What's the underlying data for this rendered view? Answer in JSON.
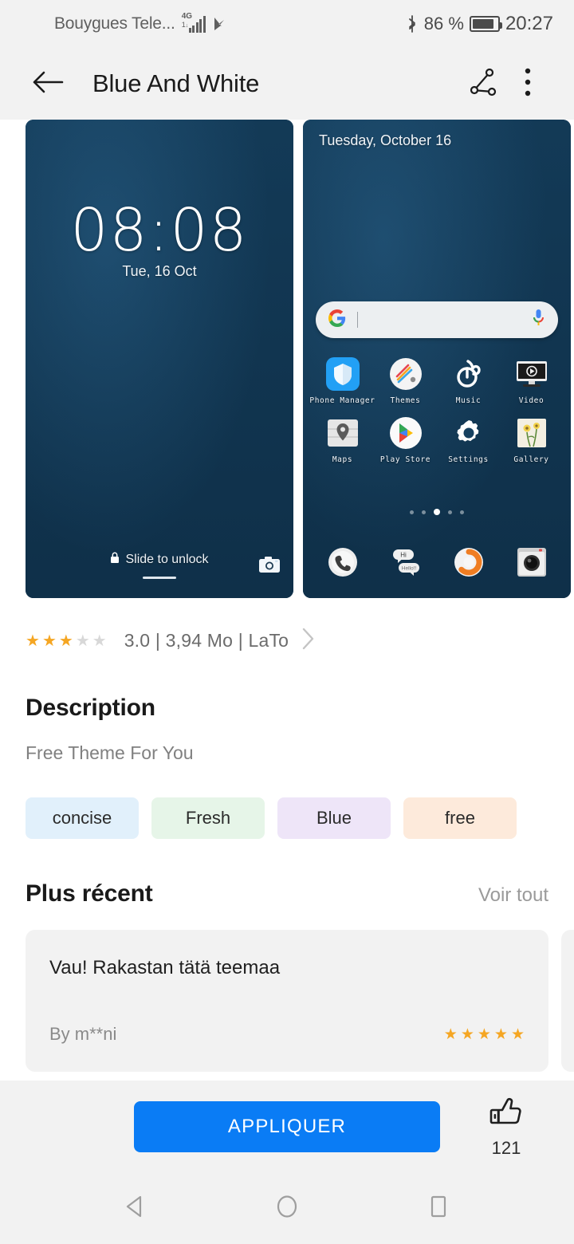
{
  "status_bar": {
    "carrier": "Bouygues Tele...",
    "network": "4G",
    "network_sub": "1↓",
    "battery_percent": "86 %",
    "time": "20:27",
    "icons": [
      "signal-icon",
      "vpn-icon",
      "bluetooth-icon",
      "battery-icon"
    ]
  },
  "app_bar": {
    "back_icon": "arrow-left-icon",
    "title": "Blue And White",
    "share_icon": "share-icon",
    "overflow_icon": "more-vertical-icon"
  },
  "previews": {
    "lockscreen": {
      "time": "08:08",
      "date": "Tue, 16 Oct",
      "unlock_text": "Slide to unlock",
      "lock_icon": "lock-icon",
      "camera_icon": "camera-icon"
    },
    "homescreen": {
      "date": "Tuesday, October 16",
      "search_placeholder": "",
      "google_icon": "google-g-icon",
      "mic_icon": "microphone-icon",
      "apps": [
        {
          "label": "Phone Manager",
          "icon": "shield-icon"
        },
        {
          "label": "Themes",
          "icon": "themes-icon"
        },
        {
          "label": "Music",
          "icon": "music-icon"
        },
        {
          "label": "Video",
          "icon": "video-icon"
        },
        {
          "label": "Maps",
          "icon": "maps-pin-icon"
        },
        {
          "label": "Play Store",
          "icon": "play-store-icon"
        },
        {
          "label": "Settings",
          "icon": "gear-icon"
        },
        {
          "label": "Gallery",
          "icon": "gallery-icon"
        }
      ],
      "dock": [
        {
          "label": "",
          "icon": "phone-icon"
        },
        {
          "label": "",
          "icon": "messages-icon"
        },
        {
          "label": "",
          "icon": "browser-icon"
        },
        {
          "label": "",
          "icon": "camera-app-icon"
        }
      ],
      "message_bubbles": [
        "Hi",
        "Hello!!"
      ],
      "page_dots": {
        "count": 5,
        "active_index": 2
      }
    }
  },
  "meta": {
    "rating_value": 3,
    "rating_max": 5,
    "text": "3.0  |  3,94  Mo  |  LaTo",
    "chevron_icon": "chevron-right-icon"
  },
  "description": {
    "heading": "Description",
    "body": "Free Theme For You",
    "tags": [
      {
        "label": "concise",
        "bg": "#e1f0fb"
      },
      {
        "label": "Fresh",
        "bg": "#e6f5e8"
      },
      {
        "label": "Blue",
        "bg": "#eee5f8"
      },
      {
        "label": "free",
        "bg": "#fdeadb"
      }
    ]
  },
  "recent": {
    "heading": "Plus récent",
    "see_all": "Voir tout",
    "reviews": [
      {
        "title": "Vau! Rakastan tätä teemaa",
        "author": "By m**ni",
        "stars": 5
      }
    ]
  },
  "bottom_bar": {
    "apply_label": "APPLIQUER",
    "like_icon": "thumbs-up-icon",
    "like_count": "121",
    "accent_color": "#0a7cf5"
  },
  "nav_bar": {
    "back_icon": "nav-back-triangle-icon",
    "home_icon": "nav-home-circle-icon",
    "recents_icon": "nav-recents-square-icon"
  }
}
